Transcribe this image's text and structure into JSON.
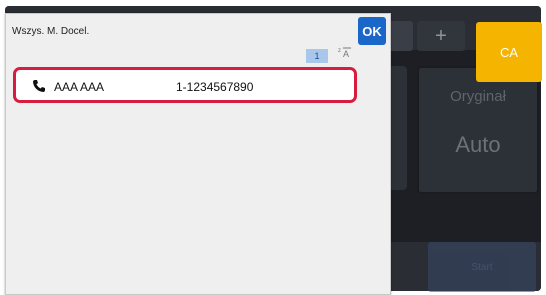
{
  "dialog": {
    "title": "Wszys. M. Docel.",
    "ok_label": "OK",
    "page_indicator": "1",
    "sort_icon": "sort-icon",
    "entries": [
      {
        "icon": "phone-icon",
        "name": "AAA AAA",
        "number": "1-1234567890"
      }
    ]
  },
  "background": {
    "ca_label": "CA",
    "plus_label": "+",
    "original_label": "Oryginał",
    "original_value": "Auto",
    "start_label": "Start"
  },
  "colors": {
    "ok_button": "#1a66c9",
    "selection_outline": "#d81c3f",
    "ca_button": "#f4b400",
    "dialog_background": "#efefef"
  }
}
